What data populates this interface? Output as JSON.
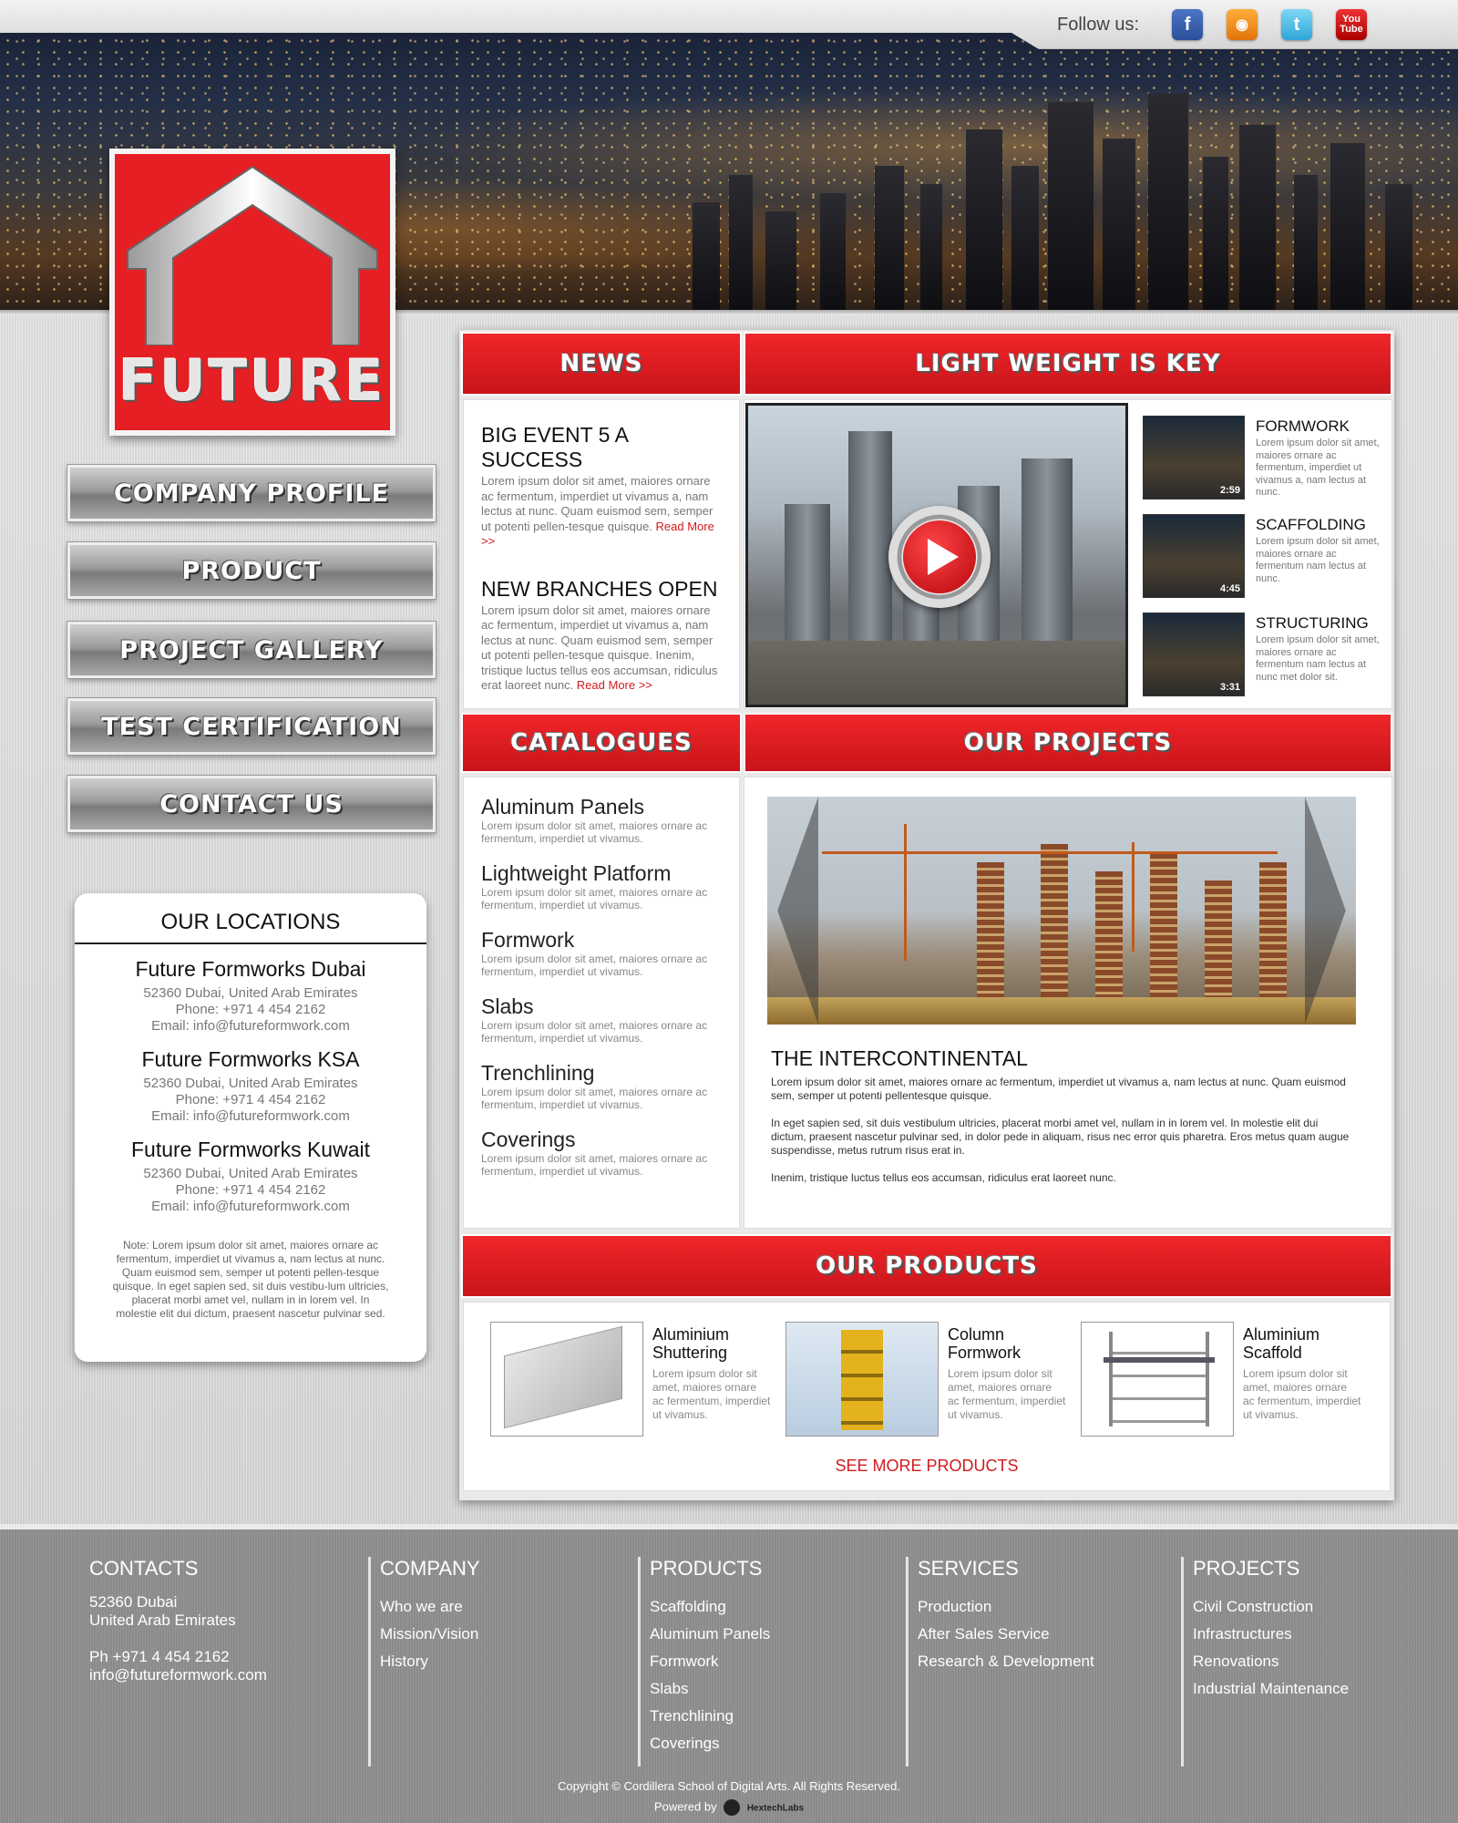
{
  "social": {
    "follow_label": "Follow us:",
    "icons": [
      "facebook-icon",
      "rss-icon",
      "twitter-icon",
      "youtube-icon"
    ],
    "youtube_text": "You Tube"
  },
  "logo": {
    "word": "FUTURE"
  },
  "nav": {
    "items": [
      {
        "label": "COMPANY PROFILE"
      },
      {
        "label": "PRODUCT"
      },
      {
        "label": "PROJECT GALLERY"
      },
      {
        "label": "TEST CERTIFICATION"
      },
      {
        "label": "CONTACT US"
      }
    ]
  },
  "locations": {
    "title": "OUR LOCATIONS",
    "offices": [
      {
        "name": "Future Formworks Dubai",
        "address": "52360 Dubai, United Arab Emirates",
        "phone": "Phone:  +971 4 454 2162",
        "email": "Email:  info@futureformwork.com"
      },
      {
        "name": "Future Formworks KSA",
        "address": "52360 Dubai, United Arab Emirates",
        "phone": "Phone:  +971 4 454 2162",
        "email": "Email:  info@futureformwork.com"
      },
      {
        "name": "Future Formworks Kuwait",
        "address": "52360 Dubai, United Arab Emirates",
        "phone": "Phone:  +971 4 454 2162",
        "email": "Email:  info@futureformwork.com"
      }
    ],
    "note": "Note:  Lorem ipsum dolor sit amet, maiores ornare ac fermentum, imperdiet ut vivamus a, nam lectus at nunc. Quam euismod sem, semper ut potenti pellen-tesque quisque.  In eget sapien sed, sit duis vestibu-lum ultricies, placerat morbi amet vel, nullam in in lorem vel. In molestie elit dui dictum, praesent nascetur pulvinar sed."
  },
  "news": {
    "heading": "NEWS",
    "items": [
      {
        "title": "BIG EVENT 5 A SUCCESS",
        "body": "Lorem ipsum dolor sit amet, maiores ornare ac fermentum, imperdiet ut vivamus a, nam lectus at nunc. Quam euismod sem, semper ut potenti pellen-tesque quisque. ",
        "more": "Read More >>"
      },
      {
        "title": "NEW BRANCHES OPEN",
        "body": "Lorem ipsum dolor sit amet, maiores ornare ac fermentum, imperdiet ut vivamus a, nam lectus at nunc. Quam euismod sem, semper ut potenti pellen-tesque quisque. Inenim, tristique luctus tellus eos accumsan, ridiculus erat laoreet nunc. ",
        "more": "Read More >>"
      }
    ]
  },
  "videos": {
    "heading": "LIGHT WEIGHT IS KEY",
    "items": [
      {
        "title": "FORMWORK",
        "duration": "2:59",
        "desc": "Lorem ipsum dolor sit amet, maiores ornare ac fermentum, imperdiet ut vivamus a, nam lectus at nunc."
      },
      {
        "title": "SCAFFOLDING",
        "duration": "4:45",
        "desc": "Lorem ipsum dolor sit amet, maiores ornare ac fermentum nam lectus at nunc."
      },
      {
        "title": "STRUCTURING",
        "duration": "3:31",
        "desc": "Lorem ipsum dolor sit amet, maiores ornare ac fermentum nam lectus at nunc met dolor sit."
      }
    ]
  },
  "catalogues": {
    "heading": "CATALOGUES",
    "items": [
      {
        "title": "Aluminum Panels",
        "desc": "Lorem ipsum dolor sit amet, maiores ornare ac fermentum, imperdiet ut vivamus."
      },
      {
        "title": "Lightweight Platform",
        "desc": "Lorem ipsum dolor sit amet, maiores ornare ac fermentum, imperdiet ut vivamus."
      },
      {
        "title": "Formwork",
        "desc": "Lorem ipsum dolor sit amet, maiores ornare ac fermentum, imperdiet ut vivamus."
      },
      {
        "title": "Slabs",
        "desc": "Lorem ipsum dolor sit amet, maiores ornare ac fermentum, imperdiet ut vivamus."
      },
      {
        "title": "Trenchlining",
        "desc": "Lorem ipsum dolor sit amet, maiores ornare ac fermentum, imperdiet ut vivamus."
      },
      {
        "title": "Coverings",
        "desc": "Lorem ipsum dolor sit amet, maiores ornare ac fermentum, imperdiet ut vivamus."
      }
    ]
  },
  "projects": {
    "heading": "OUR PROJECTS",
    "title": "THE INTERCONTINENTAL",
    "paragraphs": [
      "Lorem ipsum dolor sit amet, maiores ornare ac fermentum, imperdiet ut vivamus a, nam lectus at nunc. Quam euismod sem, semper ut potenti pellentesque quisque.",
      "In eget sapien sed, sit duis vestibulum ultricies, placerat morbi amet vel, nullam in in lorem vel. In molestie elit dui dictum, praesent nascetur pulvinar sed, in dolor pede in aliquam, risus nec error quis pharetra. Eros metus quam augue suspendisse, metus rutrum risus erat in.",
      "Inenim, tristique luctus tellus eos accumsan, ridiculus erat laoreet nunc."
    ]
  },
  "products": {
    "heading": "OUR PRODUCTS",
    "items": [
      {
        "title": "Aluminium Shuttering",
        "desc": "Lorem ipsum dolor sit amet, maiores ornare ac fermentum, imperdiet ut vivamus."
      },
      {
        "title": "Column Formwork",
        "desc": "Lorem ipsum dolor sit amet, maiores ornare ac fermentum, imperdiet ut vivamus."
      },
      {
        "title": "Aluminium Scaffold",
        "desc": "Lorem ipsum dolor sit amet, maiores ornare ac fermentum, imperdiet ut vivamus."
      }
    ],
    "see_more": "SEE MORE PRODUCTS"
  },
  "footer": {
    "contacts": {
      "heading": "CONTACTS",
      "address1": "52360 Dubai",
      "address2": "United Arab Emirates",
      "phone": "Ph +971 4 454 2162",
      "email": "info@futureformwork.com"
    },
    "company": {
      "heading": "COMPANY",
      "links": [
        "Who we are",
        "Mission/Vision",
        "History"
      ]
    },
    "products": {
      "heading": "PRODUCTS",
      "links": [
        "Scaffolding",
        "Aluminum Panels",
        "Formwork",
        "Slabs",
        "Trenchlining",
        "Coverings"
      ]
    },
    "services": {
      "heading": "SERVICES",
      "links": [
        "Production",
        "After Sales Service",
        "Research & Development"
      ]
    },
    "projects": {
      "heading": "PROJECTS",
      "links": [
        "Civil Construction",
        "Infrastructures",
        "Renovations",
        "Industrial Maintenance"
      ]
    },
    "copyright": "Copyright © Cordillera School of Digital Arts. All Rights Reserved.",
    "powered_by": "Powered by",
    "powered_brand": "HextechLabs"
  },
  "colors": {
    "accent_red": "#e51f23",
    "footer_gray": "#8f8f8f"
  }
}
